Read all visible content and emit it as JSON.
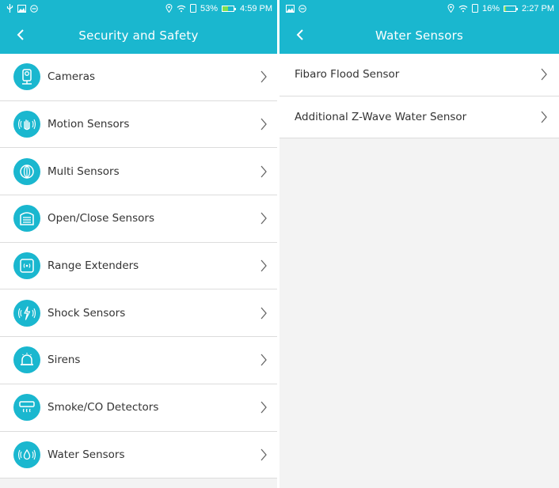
{
  "left_screen": {
    "status": {
      "battery_pct": "53%",
      "time": "4:59 PM",
      "battery_level": 0.53
    },
    "title": "Security and Safety",
    "items": [
      {
        "label": "Cameras",
        "icon": "camera-icon"
      },
      {
        "label": "Motion Sensors",
        "icon": "motion-sensor-icon"
      },
      {
        "label": "Multi Sensors",
        "icon": "multi-sensor-icon"
      },
      {
        "label": "Open/Close Sensors",
        "icon": "door-sensor-icon"
      },
      {
        "label": "Range Extenders",
        "icon": "range-extender-icon"
      },
      {
        "label": "Shock Sensors",
        "icon": "shock-sensor-icon"
      },
      {
        "label": "Sirens",
        "icon": "siren-icon"
      },
      {
        "label": "Smoke/CO Detectors",
        "icon": "smoke-detector-icon"
      },
      {
        "label": "Water Sensors",
        "icon": "water-sensor-icon"
      }
    ]
  },
  "right_screen": {
    "status": {
      "battery_pct": "16%",
      "time": "2:27 PM",
      "battery_level": 0.16
    },
    "title": "Water Sensors",
    "items": [
      {
        "label": "Fibaro Flood Sensor"
      },
      {
        "label": "Additional Z-Wave Water Sensor"
      }
    ]
  },
  "colors": {
    "accent": "#1ab7cf",
    "battery_fill": "#7ee04e"
  }
}
